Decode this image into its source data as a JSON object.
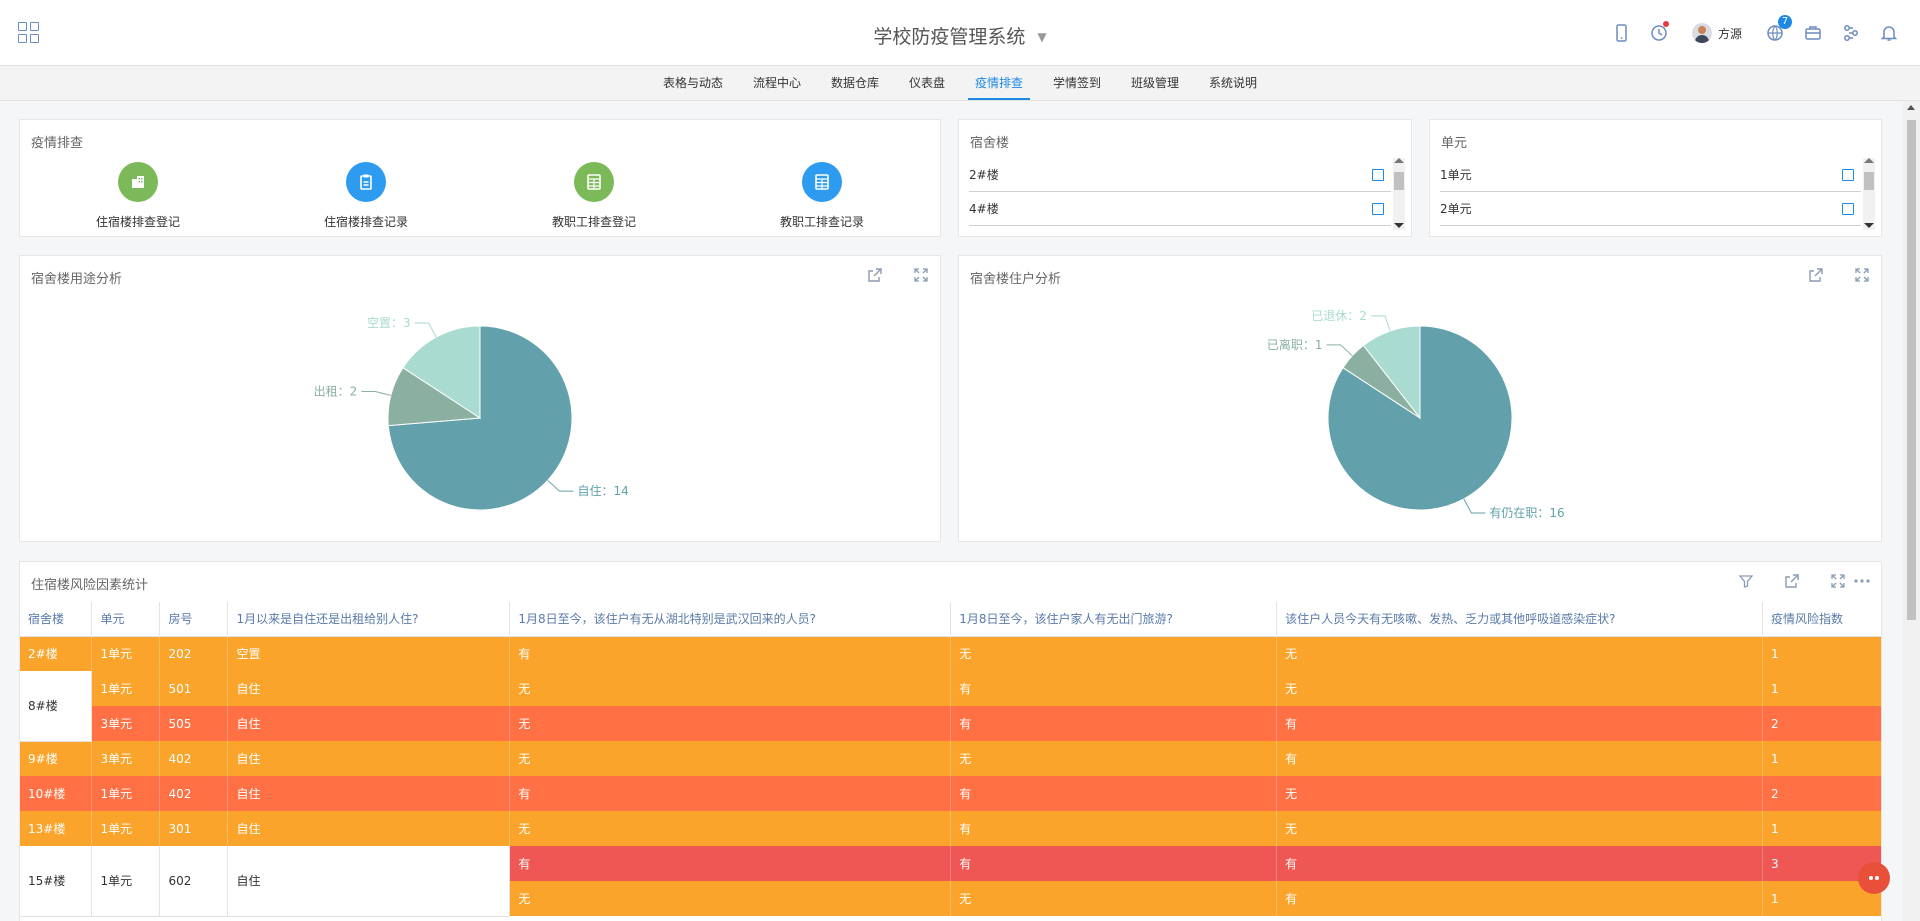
{
  "app": {
    "title": "学校防疫管理系统"
  },
  "user": {
    "name": "方源"
  },
  "notifications": {
    "count": "7"
  },
  "nav": {
    "tabs": [
      {
        "label": "表格与动态"
      },
      {
        "label": "流程中心"
      },
      {
        "label": "数据仓库"
      },
      {
        "label": "仪表盘"
      },
      {
        "label": "疫情排查",
        "active": true
      },
      {
        "label": "学情签到"
      },
      {
        "label": "班级管理"
      },
      {
        "label": "系统说明"
      }
    ]
  },
  "quick": {
    "title": "疫情排查",
    "items": [
      {
        "label": "住宿楼排查登记",
        "icon": "building-icon",
        "color": "#7cba59"
      },
      {
        "label": "住宿楼排查记录",
        "icon": "clipboard-icon",
        "color": "#2d9bef"
      },
      {
        "label": "教职工排查登记",
        "icon": "table-icon",
        "color": "#7cba59"
      },
      {
        "label": "教职工排查记录",
        "icon": "table-icon",
        "color": "#2d9bef"
      }
    ]
  },
  "filter_building": {
    "title": "宿舍楼",
    "items": [
      "2#楼",
      "4#楼"
    ]
  },
  "filter_unit": {
    "title": "单元",
    "items": [
      "1单元",
      "2单元"
    ]
  },
  "chart_usage": {
    "title": "宿舍楼用途分析"
  },
  "chart_residents": {
    "title": "宿舍楼住户分析"
  },
  "chart_data": [
    {
      "type": "pie",
      "title": "宿舍楼用途分析",
      "slices": [
        {
          "label": "自住",
          "value": 14,
          "color": "#62a1ab"
        },
        {
          "label": "出租",
          "value": 2,
          "color": "#8bb0a2"
        },
        {
          "label": "空置",
          "value": 3,
          "color": "#a9dbd0"
        }
      ]
    },
    {
      "type": "pie",
      "title": "宿舍楼住户分析",
      "slices": [
        {
          "label": "有仍在职",
          "value": 16,
          "color": "#62a1ab"
        },
        {
          "label": "已离职",
          "value": 1,
          "color": "#8bb0a2"
        },
        {
          "label": "已退休",
          "value": 2,
          "color": "#a9dbd0"
        }
      ]
    }
  ],
  "risk_table": {
    "title": "住宿楼风险因素统计",
    "headers": [
      "宿舍楼",
      "单元",
      "房号",
      "1月以来是自住还是出租给别人住?",
      "1月8日至今，该住户有无从湖北特别是武汉回来的人员?",
      "1月8日至今，该住户家人有无出门旅游?",
      "该住户人员今天有无咳嗽、发热、乏力或其他呼吸道感染症状?",
      "疫情风险指数"
    ],
    "rows": [
      {
        "building": "2#楼",
        "unit": "1单元",
        "room": "202",
        "usage": "空置",
        "q_hubei": "有",
        "q_travel": "无",
        "q_symptom": "无",
        "risk": "1"
      },
      {
        "building": "8#楼",
        "unit": "1单元",
        "room": "501",
        "usage": "自住",
        "q_hubei": "无",
        "q_travel": "有",
        "q_symptom": "无",
        "risk": "1"
      },
      {
        "building": "",
        "unit": "3单元",
        "room": "505",
        "usage": "自住",
        "q_hubei": "无",
        "q_travel": "有",
        "q_symptom": "有",
        "risk": "2"
      },
      {
        "building": "9#楼",
        "unit": "3单元",
        "room": "402",
        "usage": "自住",
        "q_hubei": "无",
        "q_travel": "无",
        "q_symptom": "有",
        "risk": "1"
      },
      {
        "building": "10#楼",
        "unit": "1单元",
        "room": "402",
        "usage": "自住",
        "q_hubei": "有",
        "q_travel": "有",
        "q_symptom": "无",
        "risk": "2"
      },
      {
        "building": "13#楼",
        "unit": "1单元",
        "room": "301",
        "usage": "自住",
        "q_hubei": "无",
        "q_travel": "有",
        "q_symptom": "无",
        "risk": "1"
      },
      {
        "building": "15#楼",
        "unit": "1单元",
        "room": "602",
        "usage": "自住",
        "q_hubei": "有",
        "q_travel": "有",
        "q_symptom": "有",
        "risk": "3"
      },
      {
        "building": "",
        "unit": "",
        "room": "",
        "usage": "",
        "q_hubei": "无",
        "q_travel": "无",
        "q_symptom": "有",
        "risk": "1"
      }
    ]
  },
  "colors": {
    "accent": "#1e88e5",
    "risk1": "#fba42b",
    "risk2": "#ff7144",
    "risk3": "#ee5753"
  }
}
